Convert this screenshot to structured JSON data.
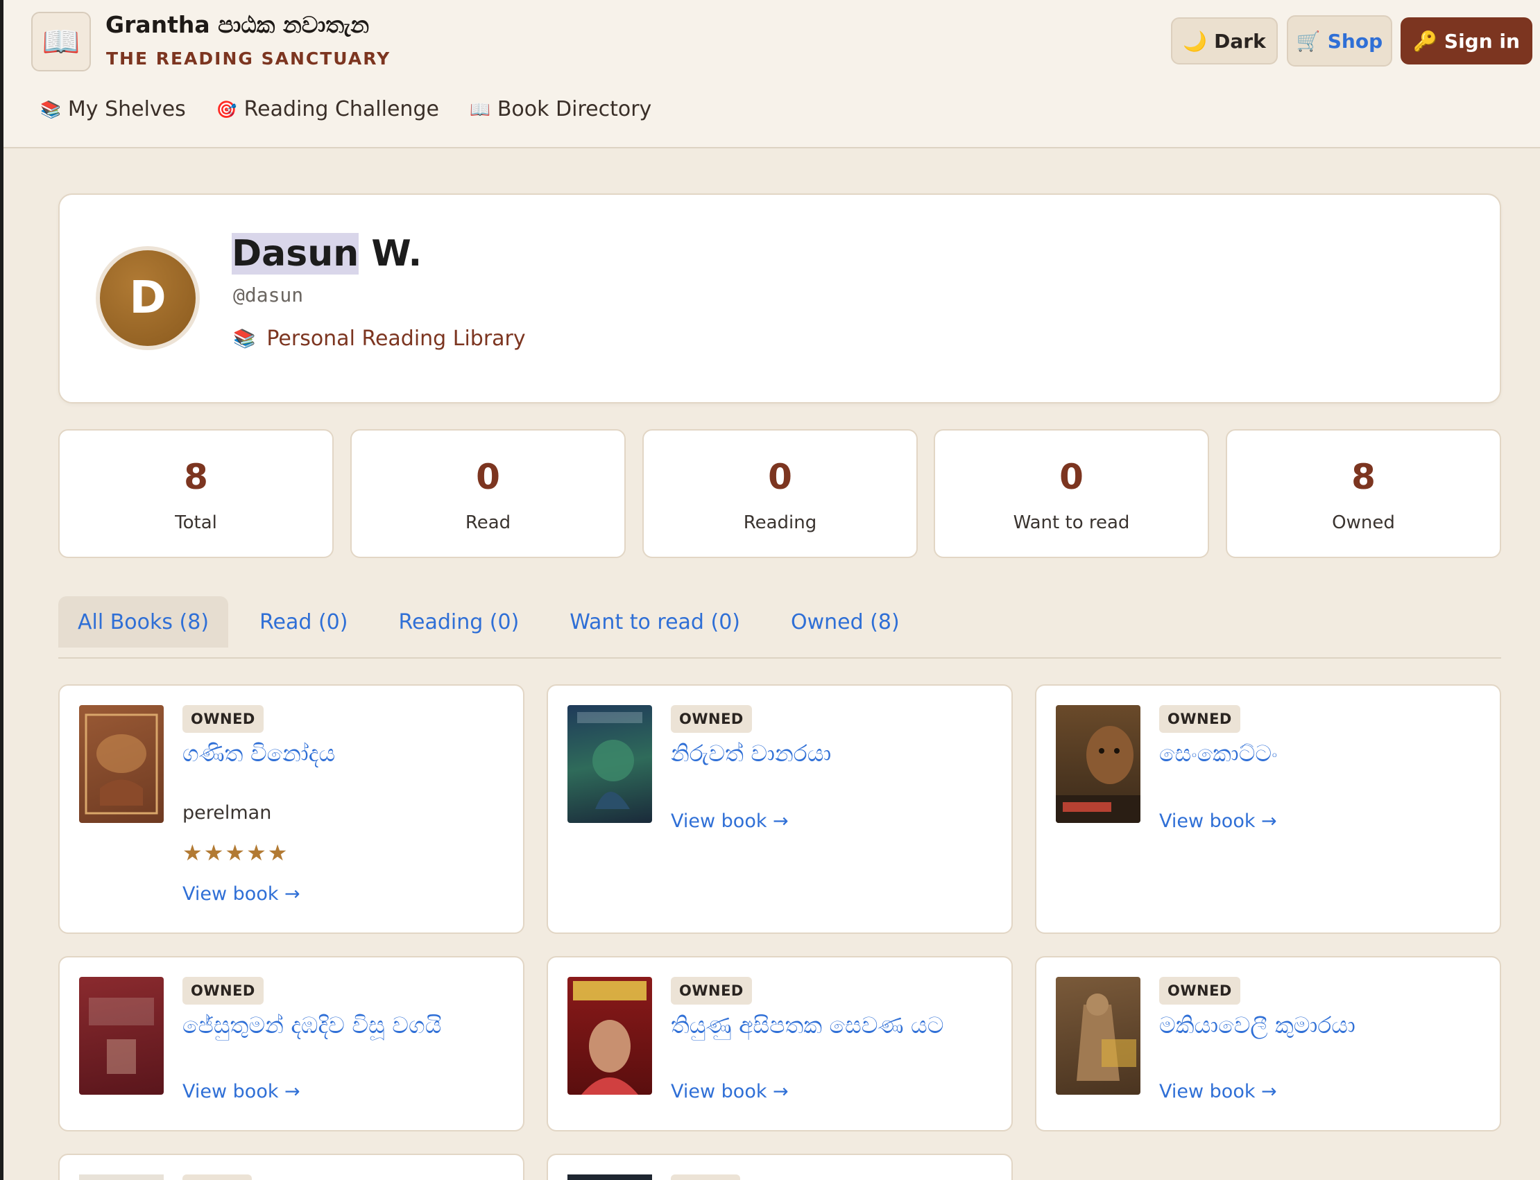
{
  "header": {
    "logo_icon": "open-book-icon",
    "brand_title": "Grantha පාඨක නවාතැන",
    "brand_subtitle": "THE READING SANCTUARY",
    "dark_label": "Dark",
    "dark_icon": "moon-icon",
    "shop_label": "Shop",
    "shop_icon": "cart-icon",
    "signin_label": "Sign in",
    "signin_icon": "key-icon"
  },
  "nav": [
    {
      "label": "My Shelves",
      "icon": "books-icon"
    },
    {
      "label": "Reading Challenge",
      "icon": "target-icon"
    },
    {
      "label": "Book Directory",
      "icon": "open-book-icon"
    }
  ],
  "profile": {
    "initial": "D",
    "name_first": "Dasun",
    "name_last": " W.",
    "handle": "@dasun",
    "library_label": "Personal Reading Library",
    "library_icon": "books-icon"
  },
  "stats": [
    {
      "value": "8",
      "label": "Total"
    },
    {
      "value": "0",
      "label": "Read"
    },
    {
      "value": "0",
      "label": "Reading"
    },
    {
      "value": "0",
      "label": "Want to read"
    },
    {
      "value": "8",
      "label": "Owned"
    }
  ],
  "tabs": [
    {
      "label": "All Books (8)",
      "active": true
    },
    {
      "label": "Read (0)",
      "active": false
    },
    {
      "label": "Reading (0)",
      "active": false
    },
    {
      "label": "Want to read (0)",
      "active": false
    },
    {
      "label": "Owned (8)",
      "active": false
    }
  ],
  "books": [
    {
      "badge": "OWNED",
      "title": "ගණිත විනෝදය",
      "author": "perelman",
      "stars": "★★★★★",
      "rating": 5,
      "link": "View book →"
    },
    {
      "badge": "OWNED",
      "title": "නිරුවත් වානරයා",
      "link": "View book →"
    },
    {
      "badge": "OWNED",
      "title": "සෙංකොට්ටං",
      "link": "View book →"
    },
    {
      "badge": "OWNED",
      "title": "ජේසුතුමන් දඹදිව විසූ වගයි",
      "link": "View book →"
    },
    {
      "badge": "OWNED",
      "title": "තියුණු අසිපතක සෙවණ යට",
      "link": "View book →"
    },
    {
      "badge": "OWNED",
      "title": "මකියාවෙලී කුමාරයා",
      "link": "View book →"
    }
  ],
  "colors": {
    "accent": "#7c3520",
    "link": "#2f6fd6",
    "background": "#f2ebe0",
    "star": "#b27a33"
  }
}
